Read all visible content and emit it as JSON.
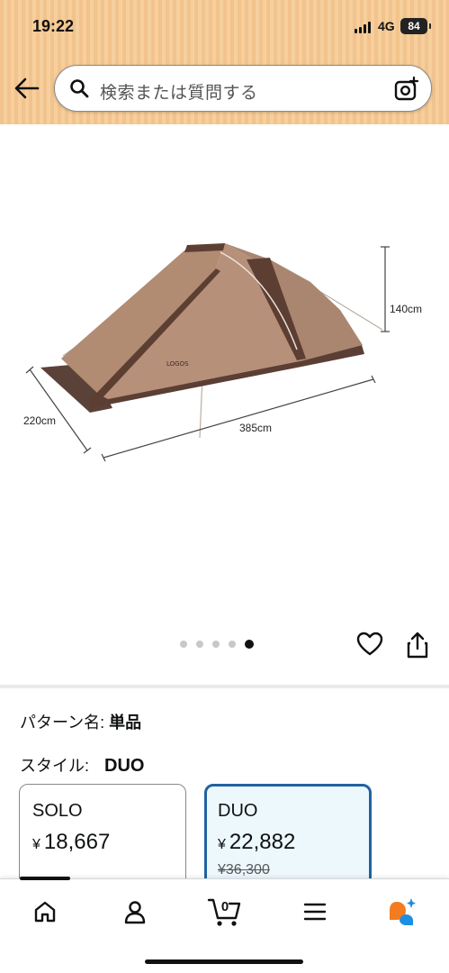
{
  "status": {
    "time": "19:22",
    "network": "4G",
    "battery": "84"
  },
  "search": {
    "placeholder": "検索または質問する"
  },
  "image": {
    "labels": {
      "height": "140cm",
      "depth": "220cm",
      "width": "385cm",
      "brand": "LOGOS"
    },
    "dots_total": 5,
    "dots_active": 5
  },
  "product": {
    "pattern_label": "パターン名:",
    "pattern_value": "単品",
    "style_label": "スタイル:",
    "style_value": "DUO",
    "options": [
      {
        "name": "SOLO",
        "currency": "¥",
        "price": "18,667",
        "selected": false
      },
      {
        "name": "DUO",
        "currency": "¥",
        "price": "22,882",
        "original": "¥36,300",
        "selected": true
      }
    ]
  },
  "nav": {
    "cart_count": "0",
    "items": [
      "home-icon",
      "account-icon",
      "cart-icon",
      "menu-icon",
      "rufus-icon"
    ]
  },
  "colors": {
    "header": "#f4c993",
    "selected_border": "#2162a1",
    "selected_bg": "#edf8fd"
  }
}
